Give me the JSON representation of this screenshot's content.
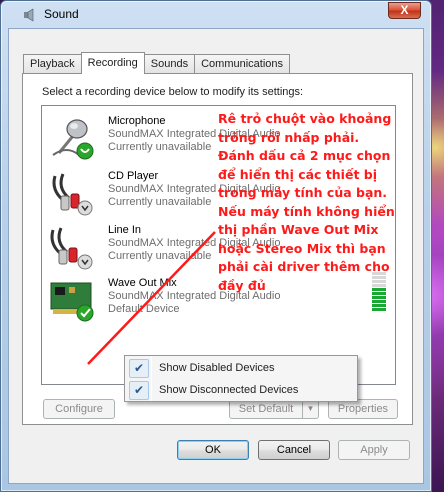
{
  "window": {
    "title": "Sound",
    "close_glyph": "X"
  },
  "tabs": [
    {
      "label": "Playback"
    },
    {
      "label": "Recording"
    },
    {
      "label": "Sounds"
    },
    {
      "label": "Communications"
    }
  ],
  "active_tab": "Recording",
  "instructions": "Select a recording device below to modify its settings:",
  "devices": [
    {
      "name": "Microphone",
      "description": "SoundMAX Integrated Digital Audio",
      "status": "Currently unavailable",
      "icon": "microphone-icon"
    },
    {
      "name": "CD Player",
      "description": "SoundMAX Integrated Digital Audio",
      "status": "Currently unavailable",
      "icon": "cd-player-icon"
    },
    {
      "name": "Line In",
      "description": "SoundMAX Integrated Digital Audio",
      "status": "Currently unavailable",
      "icon": "line-in-icon"
    },
    {
      "name": "Wave Out Mix",
      "description": "SoundMAX Integrated Digital Audio",
      "status": "Default Device",
      "icon": "wave-out-mix-icon"
    }
  ],
  "level_meter": {
    "segments_total": 10,
    "segments_lit": 6
  },
  "context_menu": [
    {
      "label": "Show Disabled Devices",
      "checked": true
    },
    {
      "label": "Show Disconnected Devices",
      "checked": true
    }
  ],
  "buttons": {
    "configure": "Configure",
    "set_default": "Set Default",
    "properties": "Properties",
    "ok": "OK",
    "cancel": "Cancel",
    "apply": "Apply"
  },
  "annotation": "Rê trỏ chuột vào khoảng trống rồi nhấp phải. Đánh dấu cả 2 mục chọn để hiển thị các thiết bị trong máy tính của bạn. Nếu máy tính không hiển thị phần Wave Out Mix hoặc Stereo Mix thì bạn phải cài driver thêm cho đầy đủ",
  "colors": {
    "annotation": "#ff1a1a",
    "status_badge": "#2ca52c",
    "level_on": "#1aa834"
  }
}
